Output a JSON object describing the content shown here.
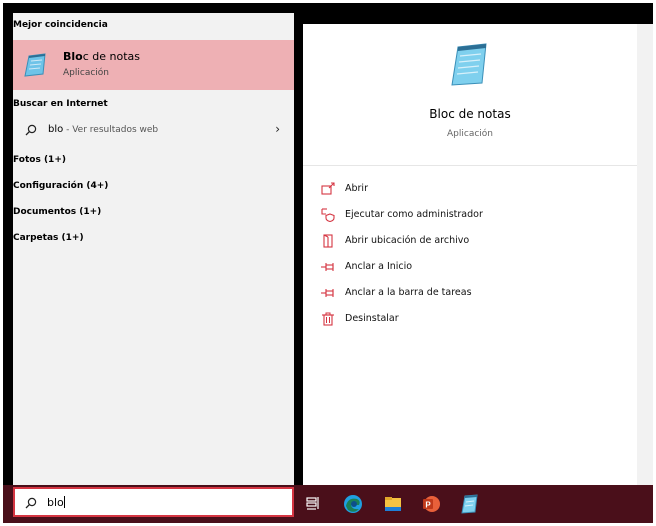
{
  "sections": {
    "best_match": "Mejor coincidencia",
    "web": "Buscar en Internet",
    "photos": "Fotos (1+)",
    "settings": "Configuración (4+)",
    "documents": "Documentos (1+)",
    "folders": "Carpetas (1+)"
  },
  "best_match": {
    "name_bold": "Blo",
    "name_rest": "c de notas",
    "type": "Aplicación"
  },
  "web_result": {
    "query": "blo",
    "suffix": " - Ver resultados web"
  },
  "detail": {
    "title": "Bloc de notas",
    "subtitle": "Aplicación",
    "actions": [
      {
        "label": "Abrir",
        "icon": "open-icon"
      },
      {
        "label": "Ejecutar como administrador",
        "icon": "run-as-admin-icon"
      },
      {
        "label": "Abrir ubicación de archivo",
        "icon": "file-location-icon"
      },
      {
        "label": "Anclar a Inicio",
        "icon": "pin-icon"
      },
      {
        "label": "Anclar a la barra de tareas",
        "icon": "pin-icon"
      },
      {
        "label": "Desinstalar",
        "icon": "trash-icon"
      }
    ]
  },
  "search": {
    "value": "blo"
  },
  "colors": {
    "accent": "#d53542",
    "highlight": "#eeb0b4",
    "taskbar": "#4a0f1a"
  }
}
